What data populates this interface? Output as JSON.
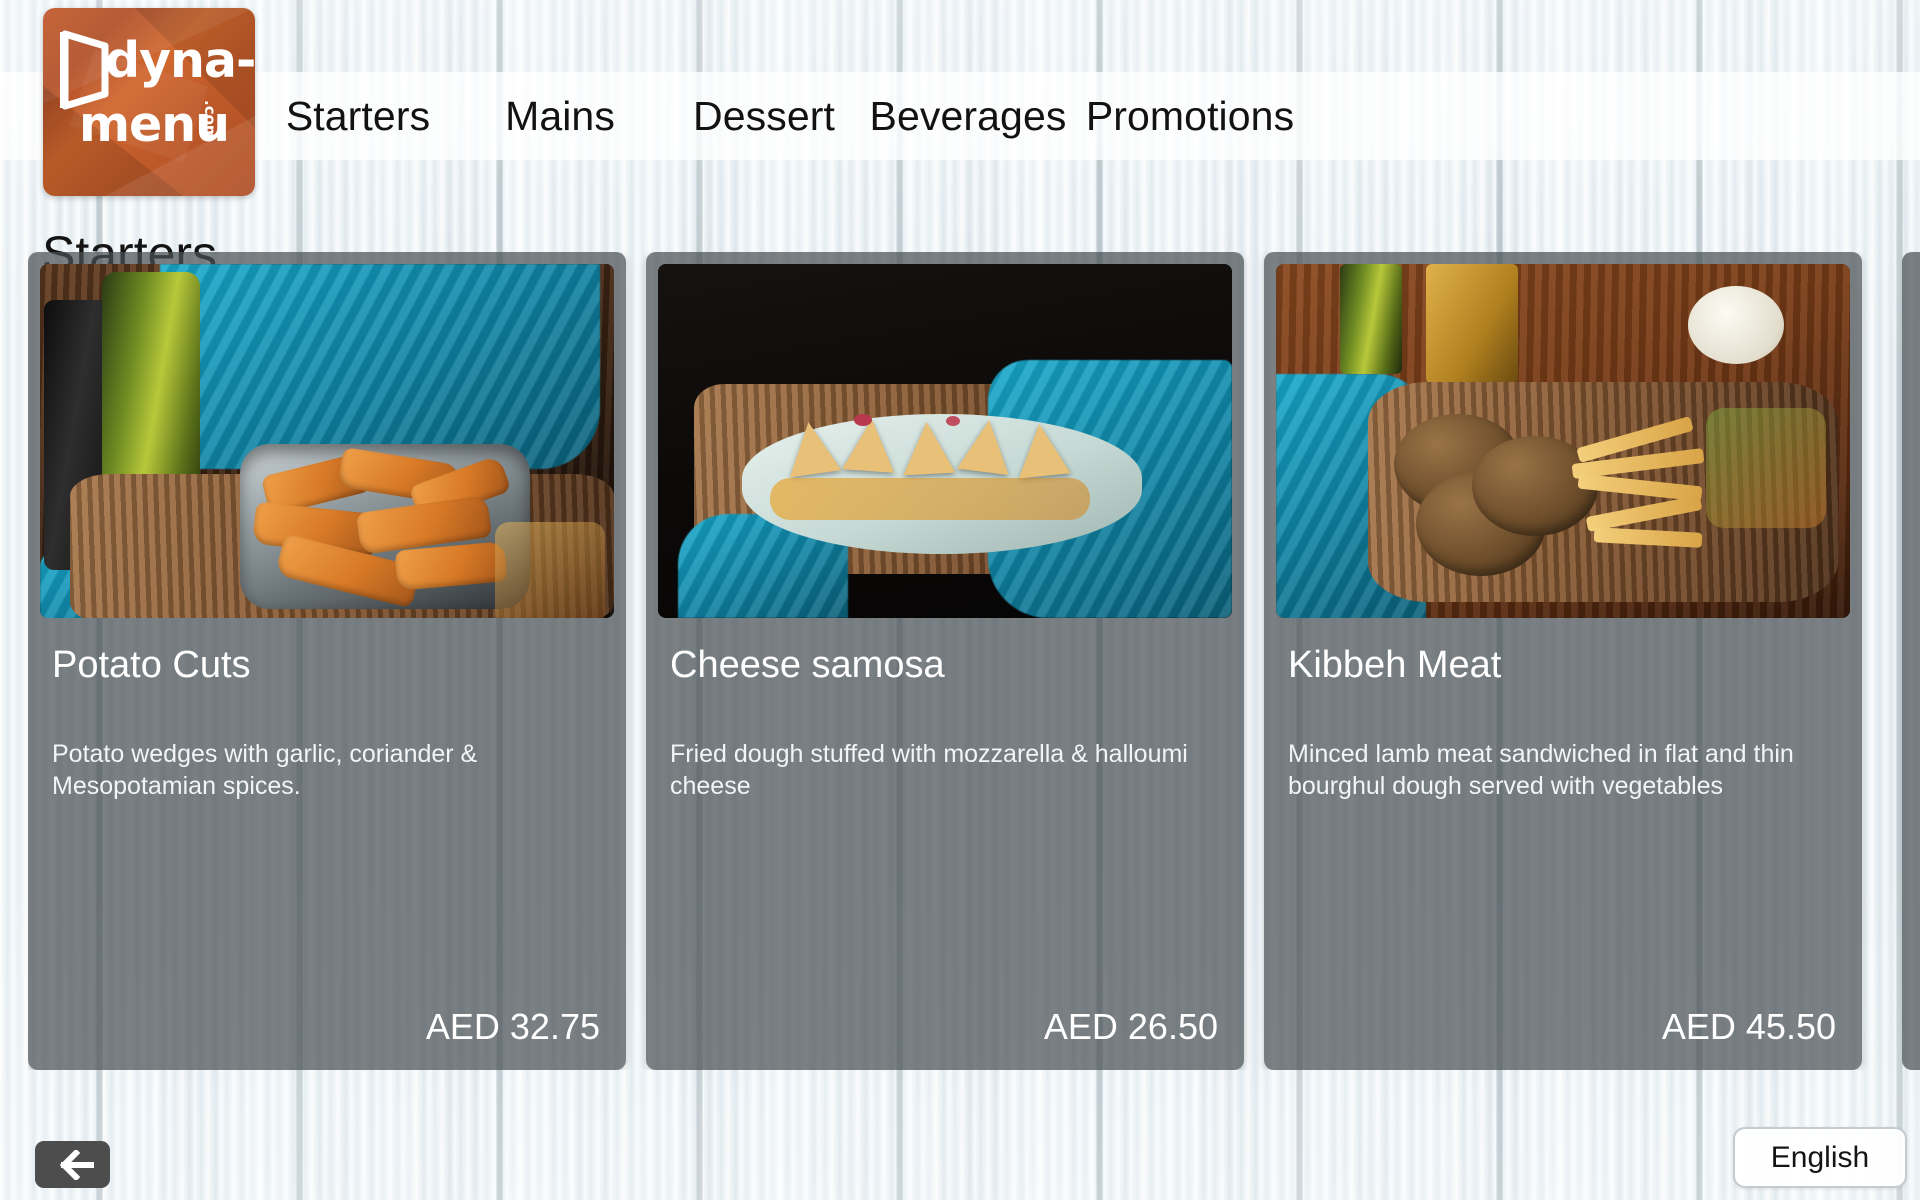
{
  "app": {
    "logo": {
      "word1": "dyna-",
      "word2": "menu",
      "dotcom": ".com",
      "mark_icon": "door-frame-logo-icon",
      "brand_color": "#c35a2c"
    }
  },
  "nav": {
    "tabs": [
      {
        "label": "Starters",
        "name": "tab-starters"
      },
      {
        "label": "Mains",
        "name": "tab-mains"
      },
      {
        "label": "Dessert",
        "name": "tab-dessert"
      },
      {
        "label": "Beverages",
        "name": "tab-beverages"
      },
      {
        "label": "Promotions",
        "name": "tab-promotions"
      }
    ],
    "active": "Starters"
  },
  "page": {
    "section_title": "Starters"
  },
  "cards": [
    {
      "title": "Potato Cuts",
      "description": "Potato wedges with garlic, coriander & Mesopotamian spices.",
      "price": "AED 32.75",
      "image_alt": "potato-cuts-photo"
    },
    {
      "title": "Cheese samosa",
      "description": "Fried dough stuffed with mozzarella & halloumi cheese",
      "price": "AED 26.50",
      "image_alt": "cheese-samosa-photo"
    },
    {
      "title": "Kibbeh Meat",
      "description": "Minced lamb meat sandwiched in flat and thin bourghul dough served with vegetables",
      "price": "AED 45.50",
      "image_alt": "kibbeh-meat-photo"
    }
  ],
  "footer": {
    "back_icon": "arrow-left-icon",
    "language_label": "English"
  },
  "colors": {
    "card_overlay": "#4a5054",
    "nav_bar": "#ffffff",
    "text_dark": "#121212",
    "text_light": "#ffffff",
    "back_button": "#4d4d4d"
  }
}
